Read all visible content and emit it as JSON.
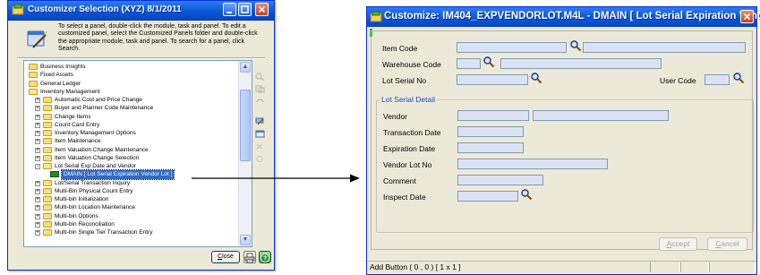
{
  "left_window": {
    "title": "Customizer Selection (XYZ) 8/1/2011",
    "instructions": "To select a panel, double-click the module, task and panel. To edit a customized panel, select the Customized Panels folder and double-click the appropriate module, task and panel. To search for a panel, click Search.",
    "tree": [
      {
        "label": "Business Insights",
        "level": 0,
        "expander": "",
        "icon": "folder"
      },
      {
        "label": "Fixed Assets",
        "level": 0,
        "expander": "",
        "icon": "folder"
      },
      {
        "label": "General Ledger",
        "level": 0,
        "expander": "",
        "icon": "folder"
      },
      {
        "label": "Inventory Management",
        "level": 0,
        "expander": "",
        "icon": "folder-open"
      },
      {
        "label": "Automatic Cost and Price Change",
        "level": 1,
        "expander": "+",
        "icon": "folder"
      },
      {
        "label": "Buyer and Planner Code Maintenance",
        "level": 1,
        "expander": "+",
        "icon": "folder"
      },
      {
        "label": "Change Items",
        "level": 1,
        "expander": "+",
        "icon": "folder"
      },
      {
        "label": "Count Card Entry",
        "level": 1,
        "expander": "+",
        "icon": "folder"
      },
      {
        "label": "Inventory Management Options",
        "level": 1,
        "expander": "+",
        "icon": "folder"
      },
      {
        "label": "Item Maintenance",
        "level": 1,
        "expander": "+",
        "icon": "folder"
      },
      {
        "label": "Item Valuation Change Maintenance",
        "level": 1,
        "expander": "+",
        "icon": "folder"
      },
      {
        "label": "Item Valuation Change Selection",
        "level": 1,
        "expander": "+",
        "icon": "folder"
      },
      {
        "label": "Lot Serial Exp Date and Vendor",
        "level": 1,
        "expander": "-",
        "icon": "folder-open"
      },
      {
        "label": "DMAIN  [ Lot Serial Expiration Vendor Lot ]",
        "level": 2,
        "expander": "",
        "icon": "panel",
        "selected": true
      },
      {
        "label": "Lot/Serial Transaction Inquiry",
        "level": 1,
        "expander": "+",
        "icon": "folder"
      },
      {
        "label": "Multi-Bin Physical Count Entry",
        "level": 1,
        "expander": "+",
        "icon": "folder"
      },
      {
        "label": "Multi-bin Initialization",
        "level": 1,
        "expander": "+",
        "icon": "folder"
      },
      {
        "label": "Multi-bin Location Maintenance",
        "level": 1,
        "expander": "+",
        "icon": "folder"
      },
      {
        "label": "Multi-bin Options",
        "level": 1,
        "expander": "+",
        "icon": "folder"
      },
      {
        "label": "Multi-bin Reconciliation",
        "level": 1,
        "expander": "+",
        "icon": "folder"
      },
      {
        "label": "Multi-bin Single Tier Transaction Entry",
        "level": 1,
        "expander": "+",
        "icon": "folder"
      }
    ],
    "close_label_first": "C",
    "close_label_rest": "lose"
  },
  "right_window": {
    "title": "Customize: IM404_EXPVENDORLOT.M4L - DMAIN  [ Lot Serial Expiration Vendo...",
    "fields": {
      "item_code": "Item Code",
      "warehouse_code": "Warehouse Code",
      "lot_serial_no": "Lot Serial No",
      "user_code": "User Code"
    },
    "group_title": "Lot Serial Detail",
    "detail_fields": {
      "vendor": "Vendor",
      "transaction_date": "Transaction Date",
      "expiration_date": "Expiration Date",
      "vendor_lot_no": "Vendor Lot No",
      "comment": "Comment",
      "inspect_date": "Inspect Date"
    },
    "accept_first": "A",
    "accept_rest": "ccept",
    "cancel_first": "C",
    "cancel_rest": "ancel",
    "status": "Add Button  ( 0 , 0 )  [ 1 x 1 ]"
  },
  "colors": {
    "titlebar": "#0a58d8",
    "selection": "#316ac5",
    "field_bg": "#dbe3f3",
    "window_bg": "#ece9d8",
    "close_button": "#c8421c"
  }
}
